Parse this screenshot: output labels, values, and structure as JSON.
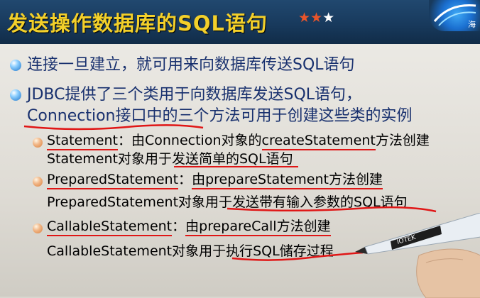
{
  "title": "发送操作数据库的SQL语句",
  "stars": {
    "filled": "★★",
    "empty": "★"
  },
  "logo_text": "海",
  "points": [
    {
      "text": "连接一旦建立，就可用来向数据库传送SQL语句"
    },
    {
      "line1": "JDBC提供了三个类用于向数据库发送SQL语句，",
      "line2": "Connection接口中的三个方法可用于创建这些类的实例"
    }
  ],
  "subpoints": [
    {
      "name": "Statement",
      "sep": "：",
      "desc_pre": "由Connection对象的",
      "method": "createStatement",
      "desc_post": "方法创建",
      "line2": "Statement对象用于发送简单的SQL语句"
    },
    {
      "name": "PreparedStatement",
      "sep": "：",
      "desc_pre": "由",
      "method": "prepareStatement",
      "desc_post": "方法创建",
      "line2": "PreparedStatement对象用于发送带有输入参数的SQL语句"
    },
    {
      "name": "CallableStatement",
      "sep": "：",
      "desc_pre": "由",
      "method": "prepareCall",
      "desc_post": "方法创建",
      "line2": "CallableStatement对象用于执行SQL储存过程"
    }
  ],
  "pen_brand": "IOTEK",
  "colors": {
    "header": "#183a5d",
    "title": "#f3d02a",
    "text_main": "#18306e",
    "annotation": "#e01616"
  }
}
